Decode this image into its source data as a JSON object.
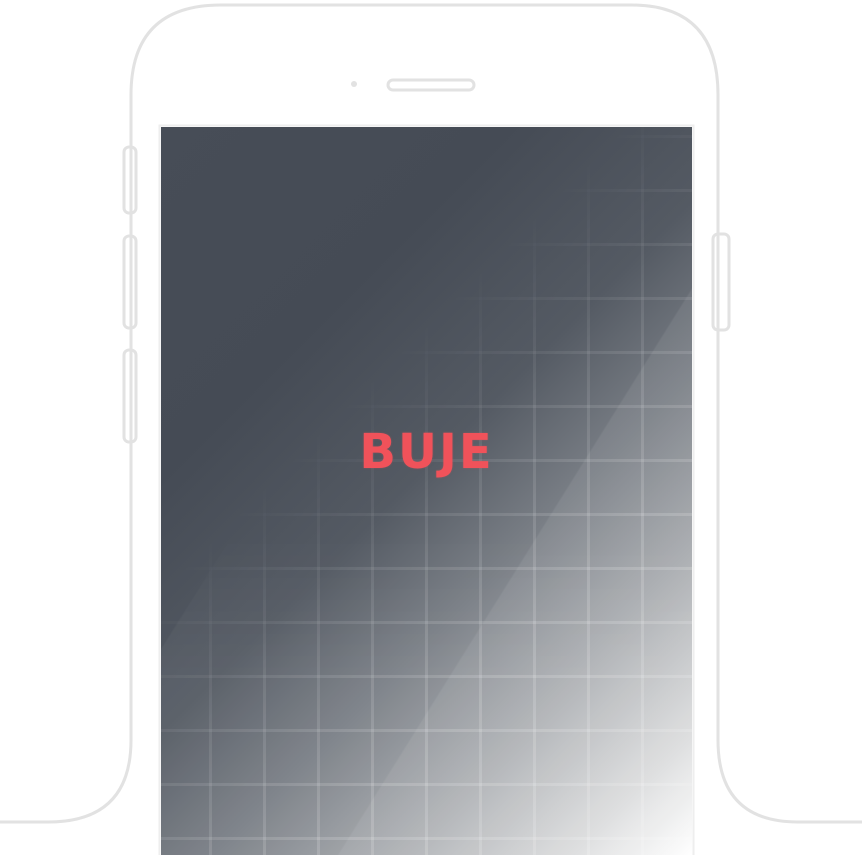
{
  "app": {
    "logo_text": "BUJE"
  },
  "colors": {
    "accent": "#f0525a",
    "screen_dark": "#454b55",
    "frame_stroke": "#e2e2e2"
  },
  "icons": {
    "earpiece": "speaker-slot",
    "camera": "front-camera-dot"
  }
}
